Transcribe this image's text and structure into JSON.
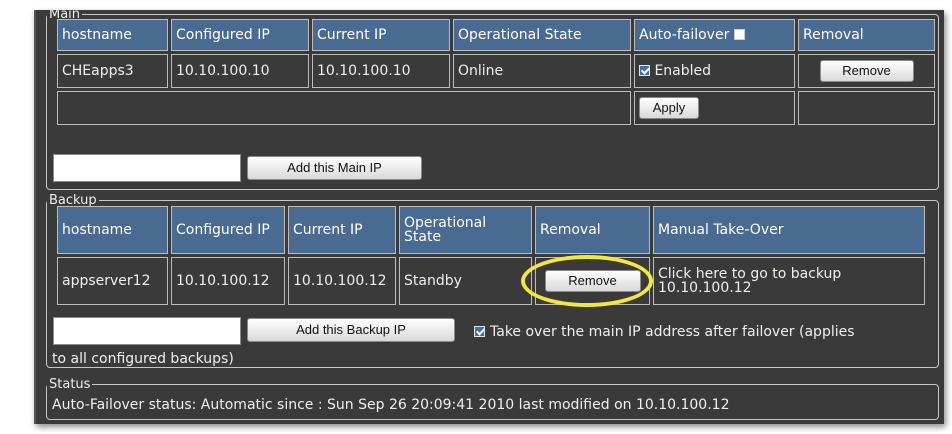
{
  "main": {
    "legend": "Main",
    "headers": {
      "hostname": "hostname",
      "configured_ip": "Configured IP",
      "current_ip": "Current IP",
      "operational_state": "Operational State",
      "auto_failover": "Auto-failover",
      "removal": "Removal"
    },
    "row": {
      "hostname": "CHEapps3",
      "configured_ip": "10.10.100.10",
      "current_ip": "10.10.100.10",
      "operational_state": "Online",
      "enabled_label": "Enabled",
      "enabled_checked": true,
      "remove_label": "Remove"
    },
    "apply_label": "Apply",
    "add_input_value": "",
    "add_button_label": "Add this Main IP"
  },
  "backup": {
    "legend": "Backup",
    "headers": {
      "hostname": "hostname",
      "configured_ip": "Configured IP",
      "current_ip": "Current IP",
      "operational_state": "Operational State",
      "removal": "Removal",
      "manual_takeover": "Manual Take-Over"
    },
    "row": {
      "hostname": "appserver12",
      "configured_ip": "10.10.100.12",
      "current_ip": "10.10.100.12",
      "operational_state": "Standby",
      "remove_label": "Remove",
      "takeover_link": "Click here to go to backup 10.10.100.12"
    },
    "add_input_value": "",
    "add_button_label": "Add this Backup IP",
    "takeover_checked": true,
    "takeover_label": "Take over the main IP address after failover (applies",
    "takeover_label_cont": "to all configured backups)"
  },
  "status": {
    "legend": "Status",
    "text": "Auto-Failover status: Automatic since : Sun Sep 26 20:09:41 2010 last modified on 10.10.100.12"
  },
  "colors": {
    "panel_bg": "#3a3a3a",
    "header_bg": "#4a6b91",
    "highlight": "#f2e640"
  }
}
